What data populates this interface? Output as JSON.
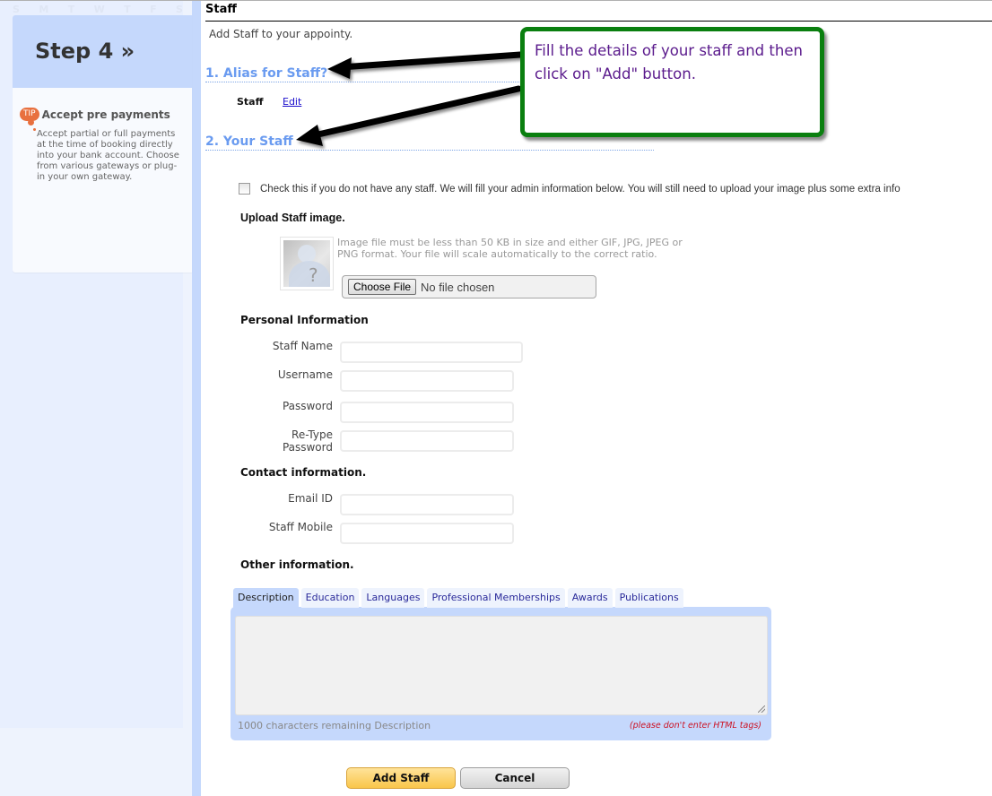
{
  "calendar": {
    "weekday_headers": [
      "S",
      "M",
      "T",
      "W",
      "T",
      "F",
      "S"
    ]
  },
  "sidebar": {
    "step_title": "Step 4 »",
    "tip": {
      "badge": "TIP",
      "title": "Accept pre payments",
      "text": "Accept partial or full payments at the time of booking directly into your bank account. Choose from various gateways or plug-in your own gateway."
    }
  },
  "page": {
    "title": "Staff",
    "subtitle": "Add Staff to your appointy."
  },
  "sections": {
    "alias": {
      "heading": "1. Alias for Staff?",
      "current_alias": "Staff",
      "edit_link": "Edit"
    },
    "your_staff": {
      "heading": "2. Your Staff"
    }
  },
  "form": {
    "no_staff_checkbox": {
      "checked": false,
      "label": "Check this if you do not have any staff. We will fill your admin information below. You will still need to upload your image plus some extra info"
    },
    "upload": {
      "heading": "Upload Staff image.",
      "hint": "Image file must be less than 50 KB in size and either GIF, JPG, JPEG or PNG format. Your file will scale automatically to the correct ratio.",
      "choose_button": "Choose File",
      "file_status": "No file chosen",
      "placeholder_glyph": "?"
    },
    "personal": {
      "heading": "Personal Information",
      "fields": [
        {
          "label": "Staff Name",
          "value": ""
        },
        {
          "label": "Username",
          "value": ""
        },
        {
          "label": "Password",
          "value": ""
        },
        {
          "label": "Re-Type Password",
          "value": ""
        }
      ]
    },
    "contact": {
      "heading": "Contact information.",
      "fields": [
        {
          "label": "Email ID",
          "value": ""
        },
        {
          "label": "Staff Mobile",
          "value": ""
        }
      ]
    },
    "other": {
      "heading": "Other information.",
      "tabs": [
        {
          "label": "Description",
          "active": true
        },
        {
          "label": "Education",
          "active": false
        },
        {
          "label": "Languages",
          "active": false
        },
        {
          "label": "Professional Memberships",
          "active": false
        },
        {
          "label": "Awards",
          "active": false
        },
        {
          "label": "Publications",
          "active": false
        }
      ],
      "description_value": "",
      "chars_remaining": "1000 characters remaining Description",
      "html_warning": "(please don't enter HTML tags)"
    },
    "buttons": {
      "add": "Add Staff",
      "cancel": "Cancel"
    }
  },
  "annotation": {
    "callout_text": "Fill the details of your staff and then click on \"Add\" button.",
    "border_color": "#0a7f0f",
    "text_color": "#5a1a8c"
  },
  "colors": {
    "section_heading": "#6a9bf0",
    "sidebar_accent": "#c5d8fc",
    "tip_badge": "#e8703f",
    "add_button": "#f9c64a",
    "warning_text": "#cc1122"
  }
}
